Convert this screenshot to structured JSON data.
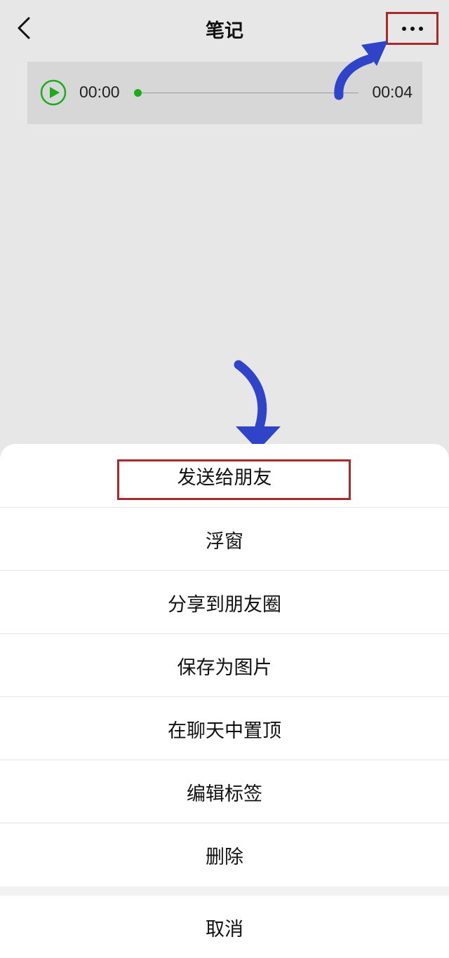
{
  "nav": {
    "title": "笔记"
  },
  "audio": {
    "current_time": "00:00",
    "total_time": "00:04",
    "progress": 0,
    "accent_color": "#1aad19"
  },
  "icons": {
    "back": "chevron-left-icon",
    "more": "more-icon",
    "play": "play-icon"
  },
  "annotations": {
    "highlight_color": "#a82a2a",
    "arrow_color": "#2f44c8"
  },
  "action_sheet": {
    "items": [
      {
        "label": "发送给朋友"
      },
      {
        "label": "浮窗"
      },
      {
        "label": "分享到朋友圈"
      },
      {
        "label": "保存为图片"
      },
      {
        "label": "在聊天中置顶"
      },
      {
        "label": "编辑标签"
      },
      {
        "label": "删除"
      }
    ],
    "cancel_label": "取消"
  }
}
